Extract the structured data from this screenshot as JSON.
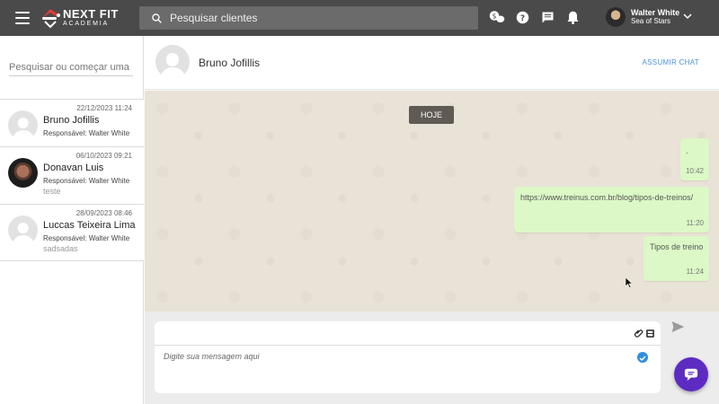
{
  "brand": {
    "name": "NEXT FIT",
    "subtitle": "ACADEMIA"
  },
  "topbar": {
    "search_placeholder": "Pesquisar clientes",
    "icons": [
      "menu-icon",
      "money-chat-icon",
      "help-icon",
      "message-icon",
      "bell-icon"
    ],
    "user": {
      "name": "Walter White",
      "org": "Sea of Stars"
    }
  },
  "sidebar": {
    "search_placeholder": "Pesquisar ou começar uma ...",
    "contacts": [
      {
        "date": "22/12/2023 11:24",
        "name": "Bruno Jofillis",
        "responsible": "Responsável: Walter White",
        "last": ""
      },
      {
        "date": "06/10/2023 09:21",
        "name": "Donavan Luis",
        "responsible": "Responsável: Walter White",
        "last": "teste"
      },
      {
        "date": "28/09/2023 08:46",
        "name": "Luccas Teixeira Lima",
        "responsible": "Responsável: Walter White",
        "last": "sadsadas"
      }
    ]
  },
  "chat": {
    "title": "Bruno Jofillis",
    "take_chat": "ASSUMIR CHAT",
    "day_label": "HOJE",
    "messages": [
      {
        "text": ".",
        "time": "10:42"
      },
      {
        "text": "https://www.treinus.com.br/blog/tipos-de-treinos/",
        "time": "11:20"
      },
      {
        "text": "Tipos de treino",
        "time": "11:24"
      }
    ]
  },
  "composer": {
    "placeholder": "Digite sua mensagem aqui"
  },
  "colors": {
    "topbar": "#4a4a4a",
    "bubble": "#dcf8c6",
    "accent": "#5d2bc1",
    "link": "#4a8fd6"
  }
}
